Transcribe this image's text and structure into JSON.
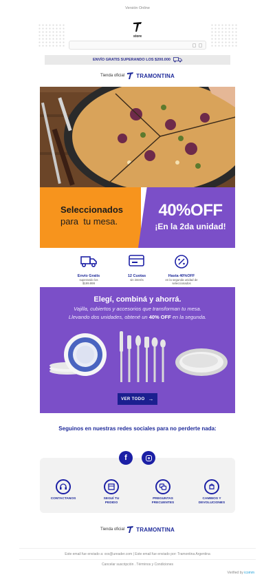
{
  "header": {
    "version_online": "Versión Online",
    "logo_text": "store",
    "shipping": "ENVÍO GRATIS SUPERANDO LOS $200.000"
  },
  "brand": {
    "official": "Tienda oficial",
    "name": "TRAMONTINA"
  },
  "promo": {
    "left_line1": "Seleccionados",
    "left_line2": "para  tu mesa.",
    "right_big": "40%OFF",
    "right_sub": "¡En la 2da unidad!"
  },
  "benefits": [
    {
      "title": "Envío Gratis",
      "sub": "superando los $199.999",
      "icon": "truck-icon"
    },
    {
      "title": "12 Cuotas",
      "sub": "sin interés",
      "icon": "card-icon"
    },
    {
      "title": "Hasta 40%OFF",
      "sub": "en la segunda unidad de seleccionados",
      "icon": "percent-icon"
    }
  ],
  "purple_block": {
    "title": "Elegí, combiná y ahorrá.",
    "line1": "Vajilla, cubiertos y accesorios que transforman tu mesa.",
    "line2_pre": "Llevando dos unidades, obtené un ",
    "line2_bold": "40% OFF",
    "line2_post": " en la segunda.",
    "button": "VER TODO"
  },
  "social": {
    "title": "Seguinos en nuestras redes sociales para no perderte nada:",
    "items": [
      {
        "label": "CONTACTANOS",
        "icon": "headset-icon"
      },
      {
        "label": "SEGUÍ TU PEDIDO",
        "icon": "tracking-icon"
      },
      {
        "label": "PREGUNTAS FRECUENTES",
        "icon": "faq-icon"
      },
      {
        "label": "CAMBIOS Y DEVOLUCIONES",
        "icon": "returns-icon"
      }
    ]
  },
  "footer": {
    "email_line": "Este email fue enviado a: xxx@ureader.com | Este email fue enviado por: Tramontina Argentina",
    "unsub": "Cancelar suscripción . Términos y Condiciones",
    "verified": "Verified by",
    "verified_brand": "icomm"
  },
  "colors": {
    "purple": "#7b4fc8",
    "orange": "#f7941d",
    "navy": "#1e2a9a"
  }
}
